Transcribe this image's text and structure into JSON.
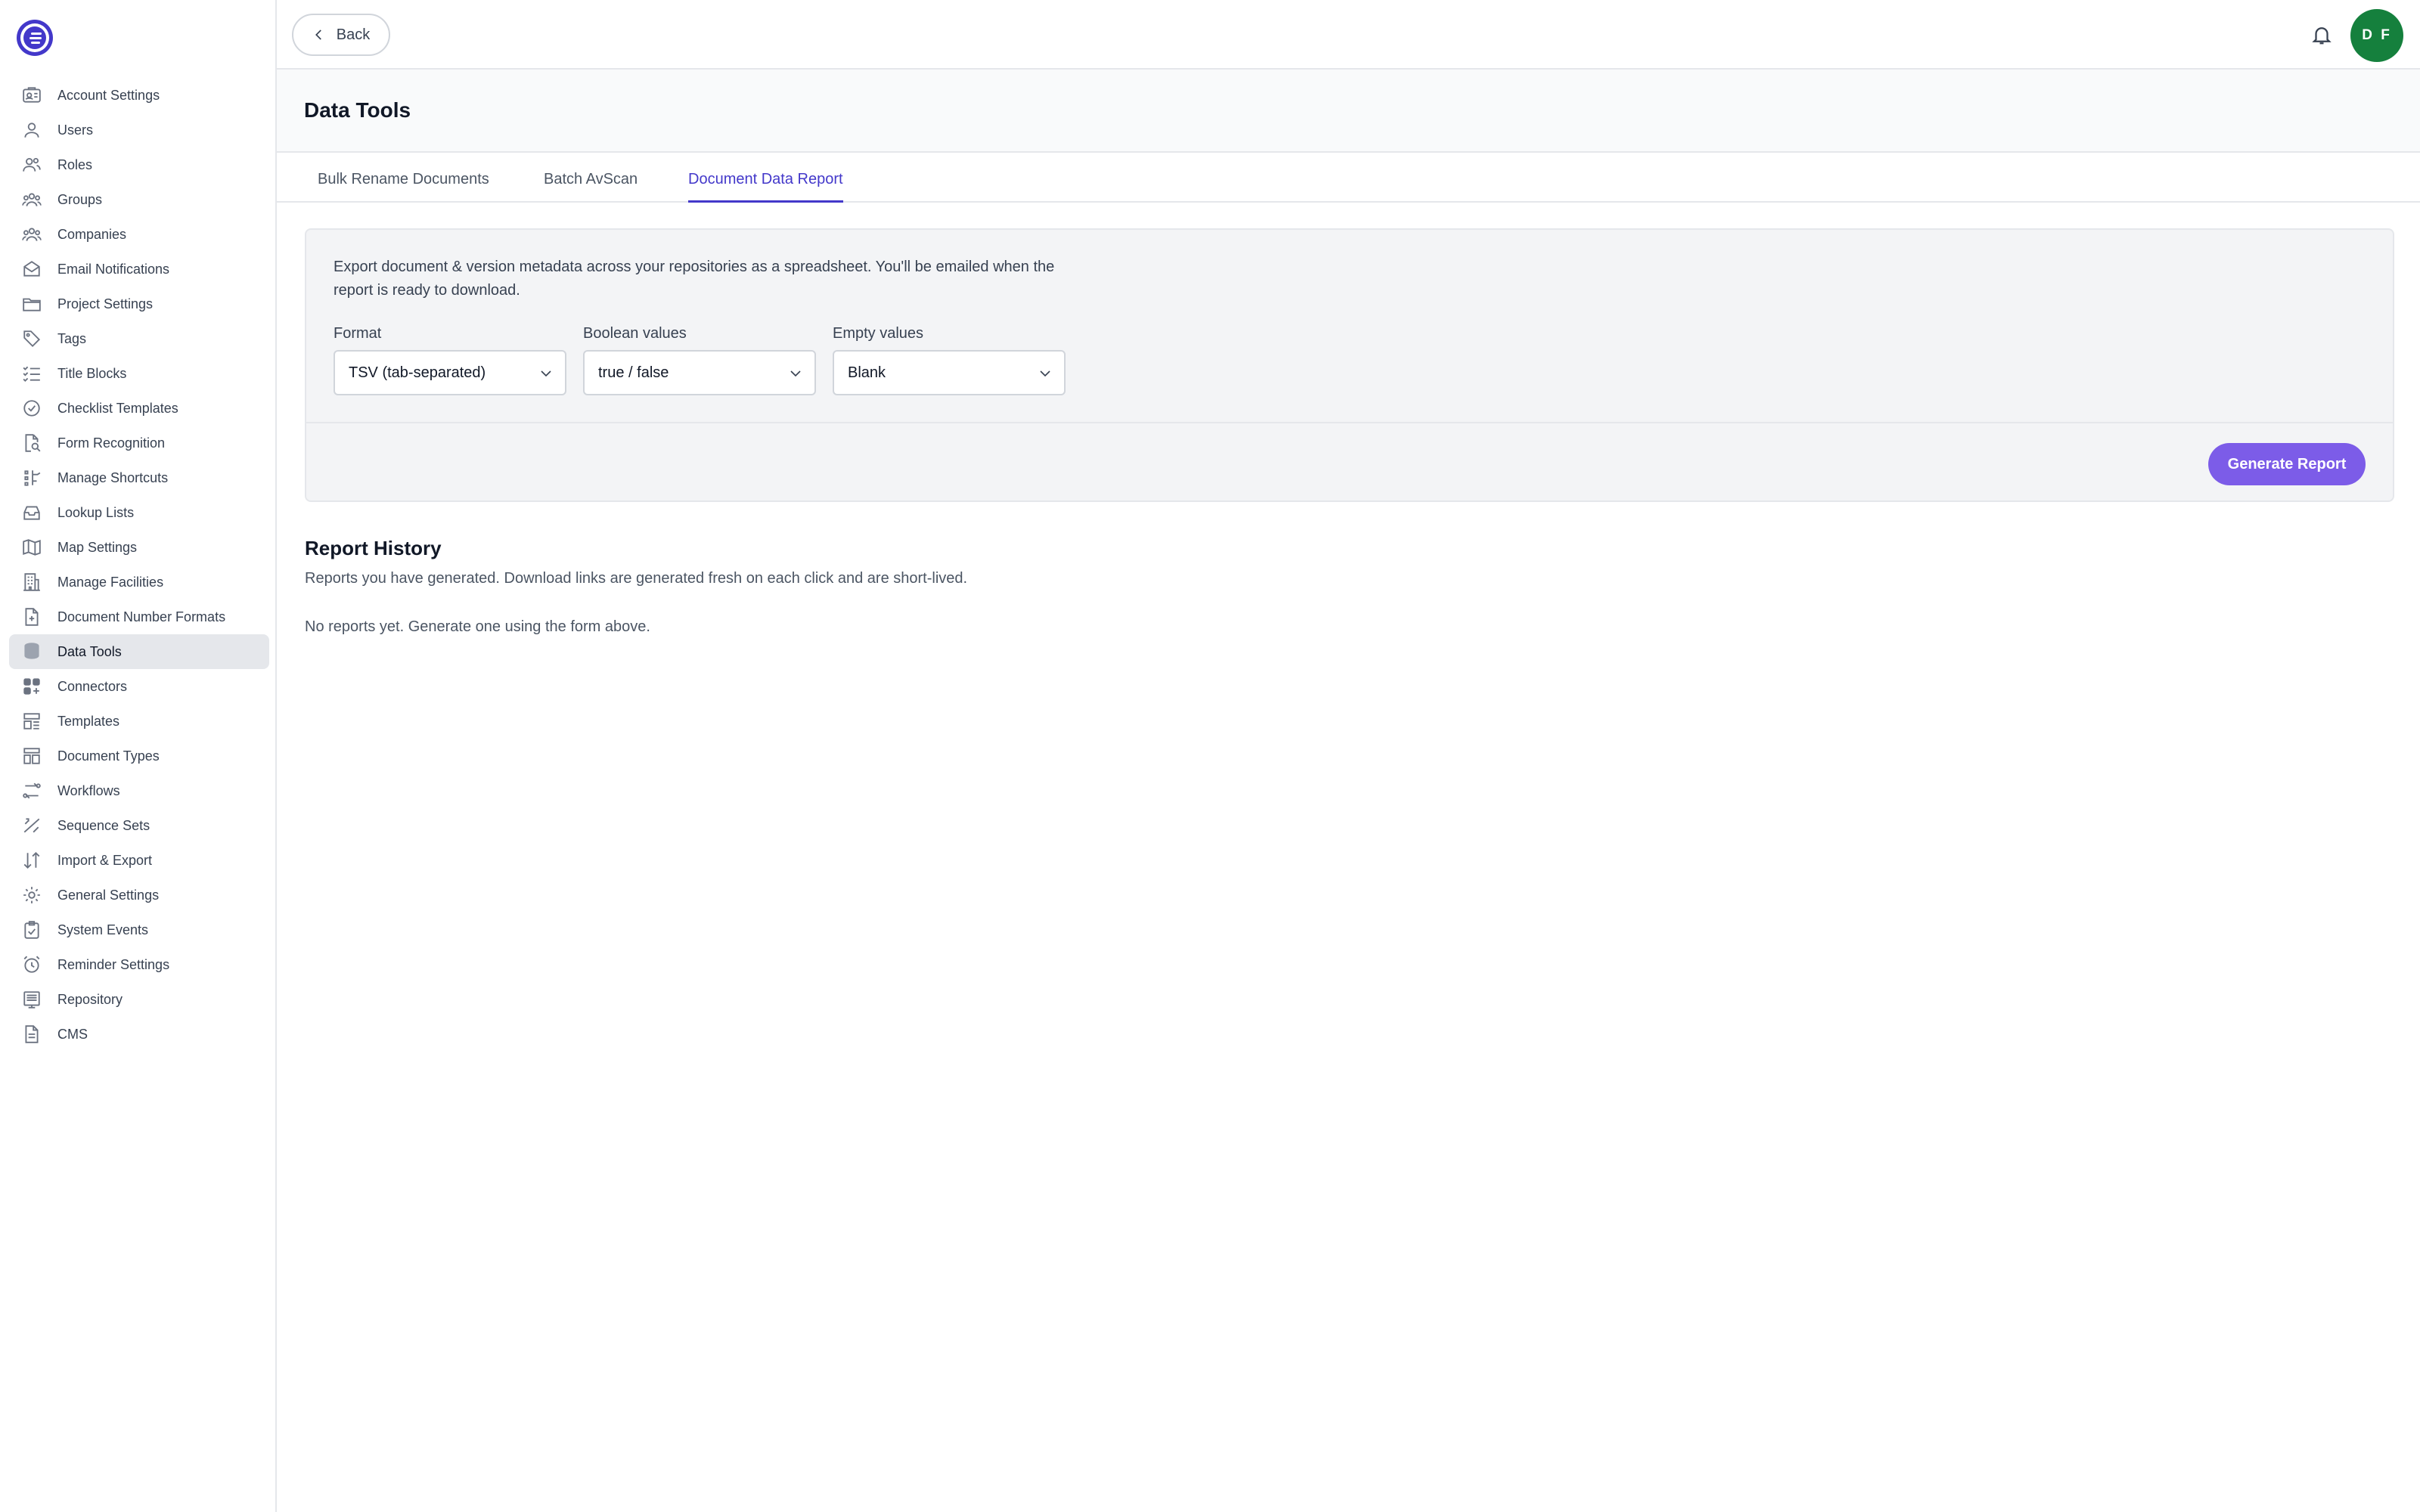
{
  "sidebar": {
    "items": [
      {
        "label": "Account Settings",
        "icon": "account-settings-icon"
      },
      {
        "label": "Users",
        "icon": "user-icon"
      },
      {
        "label": "Roles",
        "icon": "roles-icon"
      },
      {
        "label": "Groups",
        "icon": "groups-icon"
      },
      {
        "label": "Companies",
        "icon": "companies-icon"
      },
      {
        "label": "Email Notifications",
        "icon": "envelope-icon"
      },
      {
        "label": "Project Settings",
        "icon": "folder-icon"
      },
      {
        "label": "Tags",
        "icon": "tag-icon"
      },
      {
        "label": "Title Blocks",
        "icon": "list-check-icon"
      },
      {
        "label": "Checklist Templates",
        "icon": "check-circle-icon"
      },
      {
        "label": "Form Recognition",
        "icon": "document-search-icon"
      },
      {
        "label": "Manage Shortcuts",
        "icon": "shortcut-icon"
      },
      {
        "label": "Lookup Lists",
        "icon": "tray-icon"
      },
      {
        "label": "Map Settings",
        "icon": "map-icon"
      },
      {
        "label": "Manage Facilities",
        "icon": "building-icon"
      },
      {
        "label": "Document Number Formats",
        "icon": "document-plus-icon"
      },
      {
        "label": "Data Tools",
        "icon": "database-icon"
      },
      {
        "label": "Connectors",
        "icon": "grid-plus-icon"
      },
      {
        "label": "Templates",
        "icon": "template-icon"
      },
      {
        "label": "Document Types",
        "icon": "document-types-icon"
      },
      {
        "label": "Workflows",
        "icon": "workflow-icon"
      },
      {
        "label": "Sequence Sets",
        "icon": "sequence-icon"
      },
      {
        "label": "Import & Export",
        "icon": "arrows-up-down-icon"
      },
      {
        "label": "General Settings",
        "icon": "gear-icon"
      },
      {
        "label": "System Events",
        "icon": "clipboard-check-icon"
      },
      {
        "label": "Reminder Settings",
        "icon": "alarm-clock-icon"
      },
      {
        "label": "Repository",
        "icon": "repository-icon"
      },
      {
        "label": "CMS",
        "icon": "document-icon"
      }
    ],
    "active": "Data Tools"
  },
  "topbar": {
    "back_label": "Back",
    "avatar_initials": "D F"
  },
  "page": {
    "title": "Data Tools"
  },
  "tabs": [
    {
      "label": "Bulk Rename Documents"
    },
    {
      "label": "Batch AvScan"
    },
    {
      "label": "Document Data Report"
    }
  ],
  "report": {
    "description": "Export document & version metadata across your repositories as a spreadsheet. You'll be emailed when the report is ready to download.",
    "format_label": "Format",
    "format_value": "TSV (tab-separated)",
    "boolean_label": "Boolean values",
    "boolean_value": "true / false",
    "empty_label": "Empty values",
    "empty_value": "Blank",
    "generate_label": "Generate Report"
  },
  "history": {
    "title": "Report History",
    "subtitle": "Reports you have generated. Download links are generated fresh on each click and are short-lived.",
    "empty": "No reports yet. Generate one using the form above."
  },
  "colors": {
    "accent": "#4338ca",
    "button": "#7c5ce8",
    "avatar": "#15803d"
  }
}
